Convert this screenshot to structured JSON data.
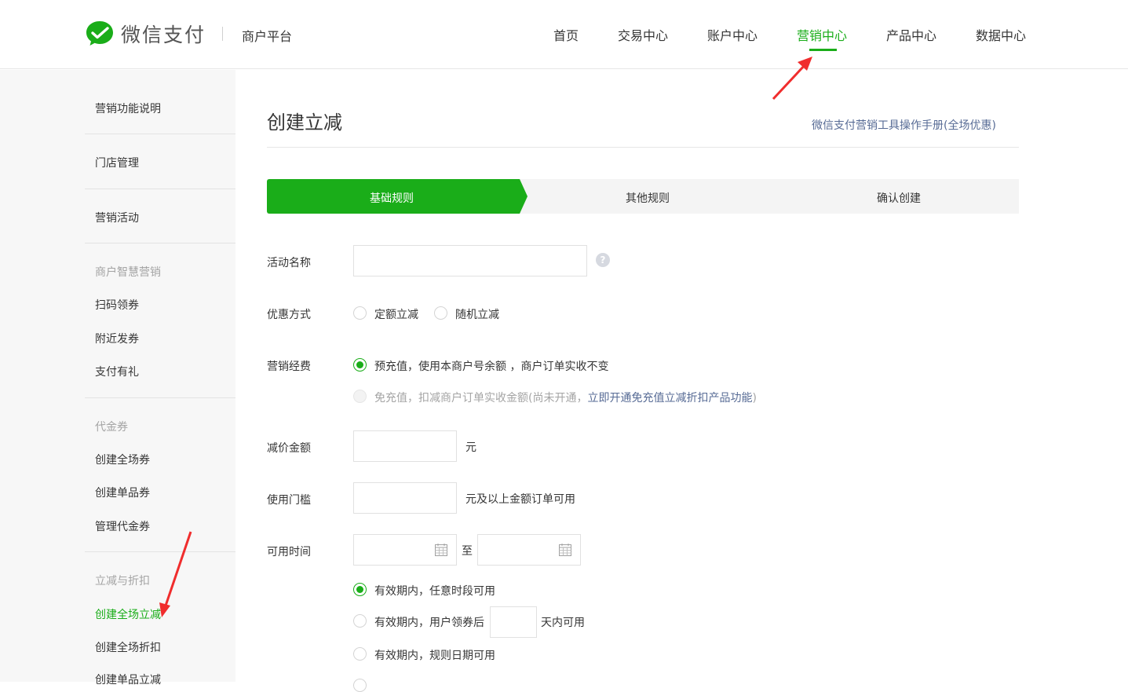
{
  "header": {
    "logo_text": "微信支付",
    "platform": "商户平台",
    "nav": [
      {
        "label": "首页",
        "active": false
      },
      {
        "label": "交易中心",
        "active": false
      },
      {
        "label": "账户中心",
        "active": false
      },
      {
        "label": "营销中心",
        "active": true
      },
      {
        "label": "产品中心",
        "active": false
      },
      {
        "label": "数据中心",
        "active": false
      }
    ]
  },
  "sidebar": {
    "item_marketing_intro": "营销功能说明",
    "item_store_manage": "门店管理",
    "item_marketing_activity": "营销活动",
    "group_smart": "商户智慧营销",
    "item_scan_coupon": "扫码领券",
    "item_nearby_coupon": "附近发券",
    "item_pay_gift": "支付有礼",
    "group_voucher": "代金券",
    "item_create_all_voucher": "创建全场券",
    "item_create_single_voucher": "创建单品券",
    "item_manage_voucher": "管理代金券",
    "group_discount": "立减与折扣",
    "item_create_all_reduce": "创建全场立减",
    "item_create_all_discount": "创建全场折扣",
    "item_create_single_reduce": "创建单品立减"
  },
  "main": {
    "title": "创建立减",
    "manual_link": "微信支付营销工具操作手册(全场优惠)",
    "steps": [
      "基础规则",
      "其他规则",
      "确认创建"
    ],
    "form": {
      "name_label": "活动名称",
      "name_value": "",
      "help_glyph": "?",
      "type_label": "优惠方式",
      "type_fixed": "定额立减",
      "type_random": "随机立减",
      "fee_label": "营销经费",
      "fee_prepaid": "预充值，使用本商户号余额 ，商户订单实收不变",
      "fee_free_prefix": "免充值，扣减商户订单实收金额(尚未开通，",
      "fee_free_link": "立即开通免充值立减折扣产品功能",
      "fee_free_suffix": ")",
      "amount_label": "减价金额",
      "amount_unit": "元",
      "threshold_label": "使用门槛",
      "threshold_unit": "元及以上金额订单可用",
      "time_label": "可用时间",
      "time_to": "至",
      "time_opt1": "有效期内，任意时段可用",
      "time_opt2_prefix": "有效期内，用户领券后",
      "time_opt2_suffix": "天内可用",
      "time_opt3": "有效期内，规则日期可用"
    }
  },
  "colors": {
    "brand_green": "#1aad19",
    "link_blue": "#576b95",
    "annotation_red": "#f02d2d"
  }
}
